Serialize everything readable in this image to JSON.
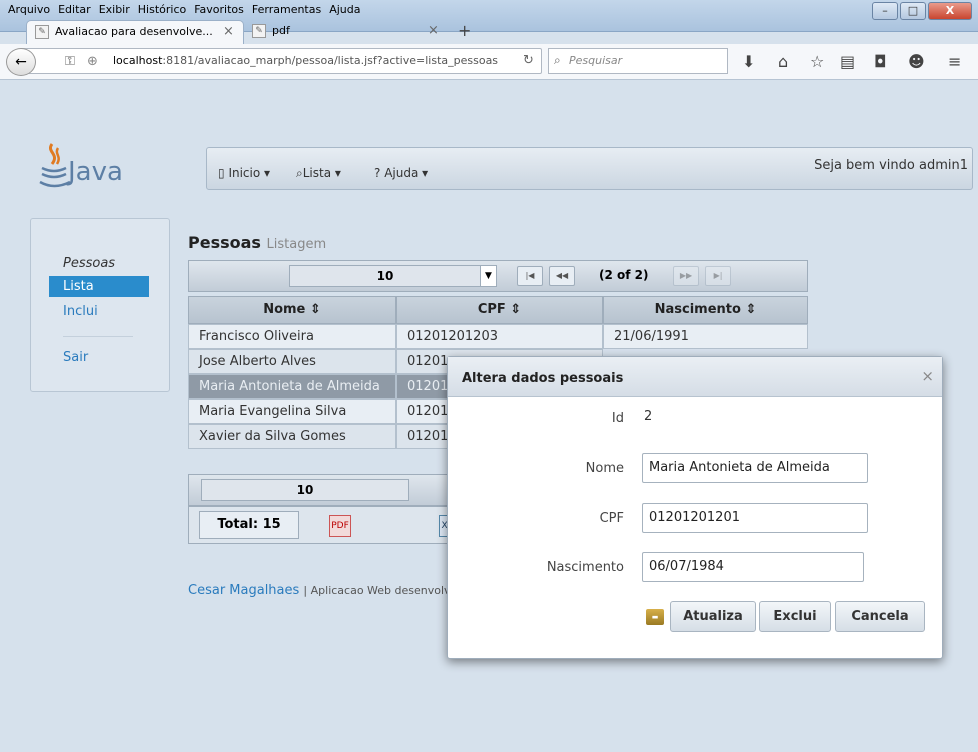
{
  "browser": {
    "menu": [
      "Arquivo",
      "Editar",
      "Exibir",
      "Histórico",
      "Favoritos",
      "Ferramentas",
      "Ajuda"
    ],
    "tabs": [
      {
        "title": "Avaliacao para desenvolve...",
        "close": "×"
      },
      {
        "title": "pdf",
        "close": "×"
      }
    ],
    "new_tab": "+",
    "url_host": "localhost",
    "url_rest": ":8181/avaliacao_marph/pessoa/lista.jsf?active=lista_pessoas",
    "search_placeholder": "Pesquisar"
  },
  "app": {
    "logo_text": "Java",
    "nav": {
      "inicio": "Inicio ▾",
      "lista": "Lista ▾",
      "ajuda": "Ajuda ▾"
    },
    "welcome": "Seja bem vindo admin1",
    "sidebar": {
      "section": "Pessoas",
      "items": [
        "Lista",
        "Inclui",
        "Sair"
      ]
    },
    "heading": {
      "title": "Pessoas",
      "subtitle": "Listagem"
    },
    "paginator": {
      "rows": "10",
      "page_info": "(2 of 2)"
    },
    "table": {
      "columns": [
        "Nome ⇕",
        "CPF ⇕",
        "Nascimento ⇕"
      ],
      "rows": [
        [
          "Francisco Oliveira",
          "01201201203",
          "21/06/1991"
        ],
        [
          "Jose Alberto Alves",
          "01201",
          ""
        ],
        [
          "Maria Antonieta de Almeida",
          "01201",
          ""
        ],
        [
          "Maria Evangelina Silva",
          "01201",
          ""
        ],
        [
          "Xavier da Silva Gomes",
          "01201",
          ""
        ]
      ]
    },
    "bottom_rows": "10",
    "total": "Total: 15",
    "footer_author": "Cesar Magalhaes",
    "footer_rest": "| Aplicacao Web desenvolv"
  },
  "dialog": {
    "title": "Altera dados pessoais",
    "close": "×",
    "id_label": "Id",
    "id_value": "2",
    "nome_label": "Nome",
    "nome_value": "Maria Antonieta de Almeida",
    "cpf_label": "CPF",
    "cpf_value": "01201201201",
    "nasc_label": "Nascimento",
    "nasc_value": "06/07/1984",
    "buttons": {
      "atualiza": "Atualiza",
      "exclui": "Exclui",
      "cancela": "Cancela"
    }
  }
}
